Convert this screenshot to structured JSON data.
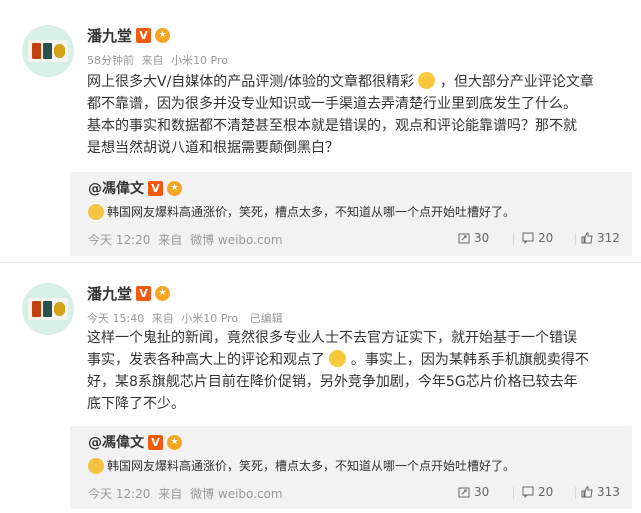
{
  "posts": [
    {
      "author": "潘九堂",
      "meta": {
        "time": "58分钟前",
        "from": "来自",
        "device": "小米10 Pro",
        "edited": ""
      },
      "body_lines": [
        "网上很多大V/自媒体的产品评测/体验的文章都很精彩",
        "，但大部分产业评论文章",
        "都不靠谱，因为很多并没专业知识或一手渠道去弄清楚行业里到底发生了什么。",
        "基本的事实和数据都不清楚甚至根本就是错误的，观点和评论能靠谱吗？那不就",
        "是想当然胡说八道和根据需要颠倒黑白？"
      ],
      "quote": {
        "author": "@馮偉文",
        "text": "韩国网友爆料高通涨价，笑死，槽点太多，不知道从哪一个点开始吐槽好了。",
        "time": "今天 12:20",
        "from": "来自",
        "source": "微博 weibo.com",
        "reposts": "30",
        "comments": "20",
        "likes": "312"
      }
    },
    {
      "author": "潘九堂",
      "meta": {
        "time": "今天 15:40",
        "from": "来自",
        "device": "小米10 Pro",
        "edited": "已编辑"
      },
      "body_lines": [
        "这样一个鬼扯的新闻，竟然很多专业人士不去官方证实下，就开始基于一个错误",
        "事实，发表各种高大上的评论和观点了",
        "。事实上，因为某韩系手机旗舰卖得不",
        "好，某8系旗舰芯片目前在降价促销，另外竞争加剧，今年5G芯片价格已较去年",
        "底下降了不少。"
      ],
      "quote": {
        "author": "@馮偉文",
        "text": "韩国网友爆料高通涨价，笑死，槽点太多，不知道从哪一个点开始吐槽好了。",
        "time": "今天 12:20",
        "from": "来自",
        "source": "微博 weibo.com",
        "reposts": "30",
        "comments": "20",
        "likes": "313"
      }
    }
  ],
  "colors": {
    "verified_badge": "#f25a10",
    "quote_background": "#f2f2f2",
    "meta_text": "#999999"
  },
  "icons": {
    "verified": "V",
    "medal": "medal-icon",
    "repost": "repost-icon",
    "comment": "comment-icon",
    "like": "like-icon",
    "emoji_thumb": "thumbs-up-emoji",
    "emoji_laugh": "laugh-emoji",
    "emoji_face": "face-emoji"
  }
}
